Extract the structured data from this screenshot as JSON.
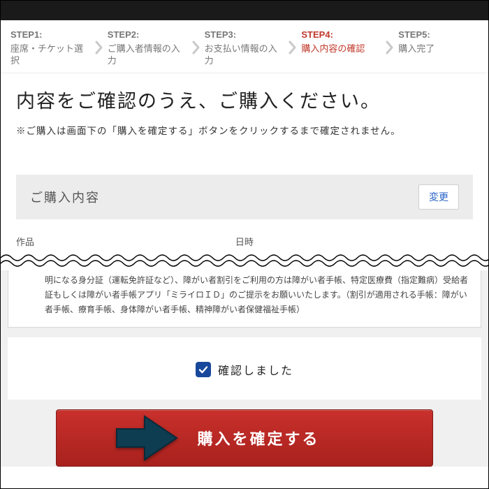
{
  "steps": {
    "s1": {
      "num": "STEP1:",
      "label": "座席・チケット選択"
    },
    "s2": {
      "num": "STEP2:",
      "label": "ご購入者情報の入力"
    },
    "s3": {
      "num": "STEP3:",
      "label": "お支払い情報の入力"
    },
    "s4": {
      "num": "STEP4:",
      "label": "購入内容の確認"
    },
    "s5": {
      "num": "STEP5:",
      "label": "購入完了"
    }
  },
  "headline": "内容をご確認のうえ、ご購入ください。",
  "note": "※ご購入は画面下の「購入を確定する」ボタンをクリックするまで確定されません。",
  "section": {
    "title": "ご購入内容",
    "change": "変更"
  },
  "table": {
    "col1": "作品",
    "col2": "日時"
  },
  "infobox": "明になる身分証（運転免許証など）、障がい者割引をご利用の方は障がい者手帳、特定医療費（指定難病）受給者証もしくは障がい者手帳アプリ「ミライロＩＤ」のご提示をお願いいたします。（割引が適用される手帳：障がい者手帳、療育手帳、身体障がい者手帳、精神障がい者保健福祉手帳）",
  "confirm": {
    "label": "確認しました"
  },
  "buy": {
    "label": "購入を確定する"
  }
}
